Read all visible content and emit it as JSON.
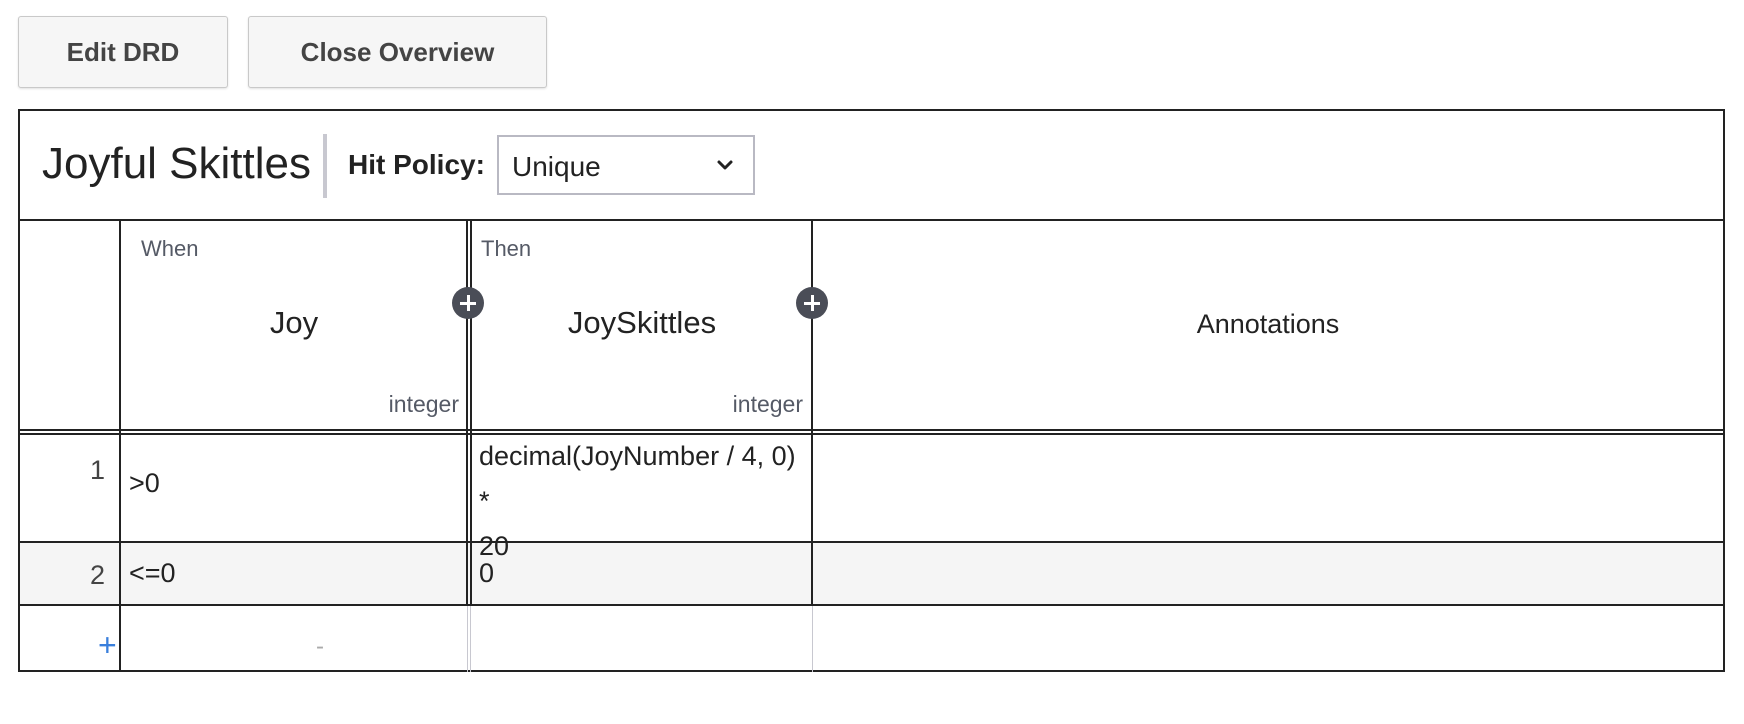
{
  "toolbar": {
    "edit_drd_label": "Edit DRD",
    "close_overview_label": "Close Overview"
  },
  "decision": {
    "name": "Joyful Skittles",
    "hit_policy_label": "Hit Policy:",
    "hit_policy_value": "Unique"
  },
  "table": {
    "when_label": "When",
    "then_label": "Then",
    "input": {
      "name": "Joy",
      "type": "integer"
    },
    "output": {
      "name": "JoySkittles",
      "type": "integer"
    },
    "annotations_label": "Annotations",
    "rows": [
      {
        "number": "1",
        "input": ">0",
        "output_line1": "decimal(JoyNumber / 4, 0) *",
        "output_line2": "20",
        "annotation": ""
      },
      {
        "number": "2",
        "input": "<=0",
        "output_line1": "0",
        "output_line2": "",
        "annotation": ""
      }
    ],
    "add_row_symbol": "+",
    "empty_input_placeholder": "-"
  },
  "icons": {
    "add_input": "plus-circle-icon",
    "add_output": "plus-circle-icon",
    "select_chevron": "chevron-down-icon"
  },
  "colors": {
    "border": "#222222",
    "add_row_accent": "#3a7fdc",
    "plus_circle": "#4a4d57",
    "row_alt_bg": "#f5f5f5"
  }
}
